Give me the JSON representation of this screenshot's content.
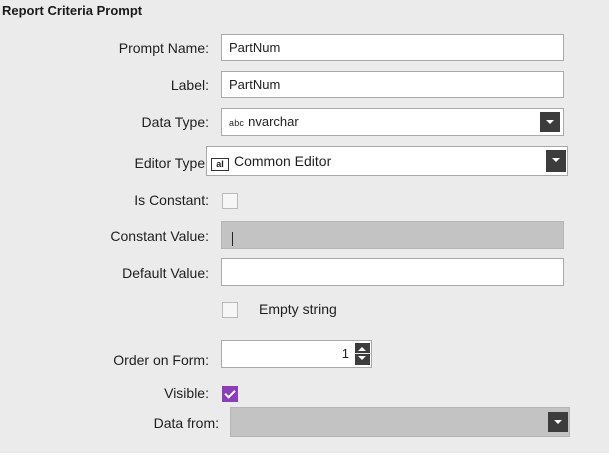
{
  "panel": {
    "title": "Report Criteria Prompt"
  },
  "prompt_name": {
    "label": "Prompt Name:",
    "value": "PartNum"
  },
  "label_field": {
    "label": "Label:",
    "value": "PartNum"
  },
  "data_type": {
    "label": "Data Type:",
    "icon_text": "abc",
    "value": "nvarchar"
  },
  "editor_type": {
    "label": "Editor Type:",
    "icon_text": "aI",
    "value": "Common Editor"
  },
  "is_constant": {
    "label": "Is Constant:",
    "checked": false
  },
  "constant_value": {
    "label": "Constant Value:",
    "value": ""
  },
  "default_value": {
    "label": "Default Value:",
    "value": ""
  },
  "empty_string": {
    "label": "Empty string",
    "checked": false
  },
  "order_on_form": {
    "label": "Order on Form:",
    "value": "1"
  },
  "visible": {
    "label": "Visible:",
    "checked": true
  },
  "data_from": {
    "label": "Data from:",
    "value": ""
  },
  "colors": {
    "accent": "#8a3fb9",
    "panel_bg": "#ebebeb",
    "disabled_bg": "#c3c3c3",
    "button_dark": "#3c3c3c"
  }
}
